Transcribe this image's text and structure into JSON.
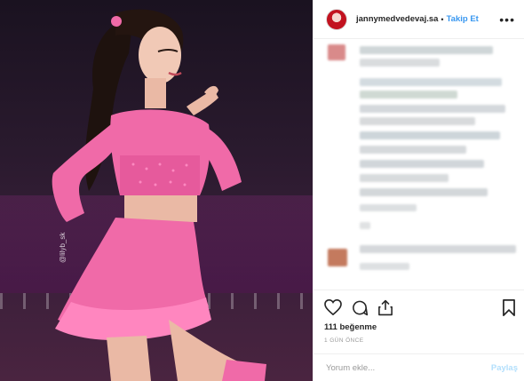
{
  "post": {
    "photo_watermark": "@lilyb_sk",
    "photo_alt_icon": "skater-photo"
  },
  "header": {
    "username": "jannymedvedevaj.sa",
    "separator": "•",
    "follow_label": "Takip Et",
    "more_icon": "more-options-icon",
    "more_label": "•••"
  },
  "actions": {
    "like_icon": "heart-icon",
    "comment_icon": "comment-icon",
    "share_icon": "share-icon",
    "save_icon": "bookmark-icon",
    "likes_text": "111 beğenme",
    "time_text": "1 GÜN ÖNCE"
  },
  "comment_box": {
    "placeholder": "Yorum ekle...",
    "post_label": "Paylaş"
  },
  "colors": {
    "follow": "#3897f0",
    "post_disabled": "#b2dffc",
    "outfit_pink": "#f06aa8"
  }
}
